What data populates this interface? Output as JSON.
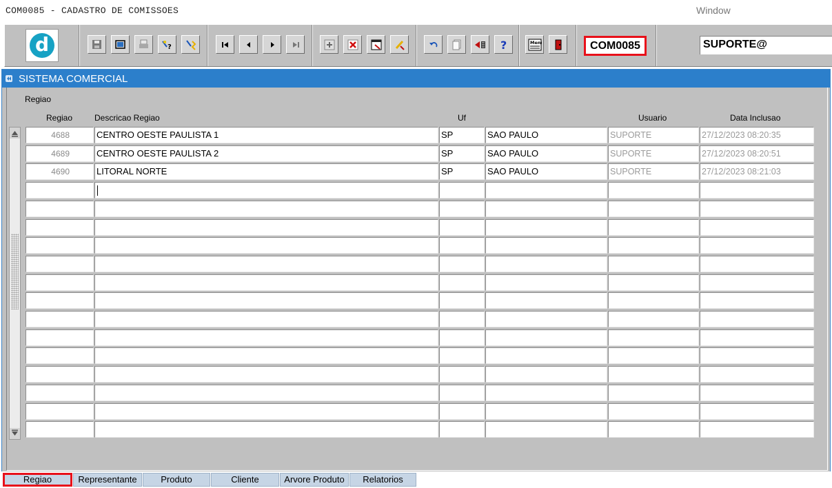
{
  "window": {
    "title": "COM0085 - CADASTRO DE COMISSOES",
    "menu": "Window"
  },
  "toolbar": {
    "form_code": "COM0085",
    "user": "SUPORTE@",
    "buttons": [
      "save-icon",
      "window-icon",
      "print-icon",
      "query-help-icon",
      "query-run-icon",
      "first-record-icon",
      "previous-record-icon",
      "next-record-icon",
      "last-record-icon",
      "insert-record-icon",
      "delete-record-icon",
      "edit-record-icon",
      "clear-record-icon",
      "undo-icon",
      "copy-icon",
      "exit-form-icon",
      "help-icon",
      "menu-icon",
      "exit-door-icon"
    ]
  },
  "form": {
    "title": "SISTEMA COMERCIAL",
    "block_label": "Regiao",
    "columns": {
      "regiao": "Regiao",
      "descricao": "Descricao Regiao",
      "uf": "Uf",
      "usuario": "Usuario",
      "data": "Data Inclusao"
    },
    "rows": [
      {
        "regiao": "4688",
        "descricao": "CENTRO OESTE PAULISTA 1",
        "uf": "SP",
        "estado": "SAO PAULO",
        "usuario": "SUPORTE",
        "data": "27/12/2023 08:20:35"
      },
      {
        "regiao": "4689",
        "descricao": "CENTRO OESTE PAULISTA 2",
        "uf": "SP",
        "estado": "SAO PAULO",
        "usuario": "SUPORTE",
        "data": "27/12/2023 08:20:51"
      },
      {
        "regiao": "4690",
        "descricao": "LITORAL NORTE",
        "uf": "SP",
        "estado": "SAO PAULO",
        "usuario": "SUPORTE",
        "data": "27/12/2023 08:21:03"
      }
    ],
    "empty_rows": 14,
    "active_row": 3
  },
  "tabs": [
    {
      "label": "Regiao",
      "active": true
    },
    {
      "label": "Representante"
    },
    {
      "label": "Produto"
    },
    {
      "label": "Cliente"
    },
    {
      "label": "Arvore Produto"
    },
    {
      "label": "Relatorios"
    }
  ]
}
